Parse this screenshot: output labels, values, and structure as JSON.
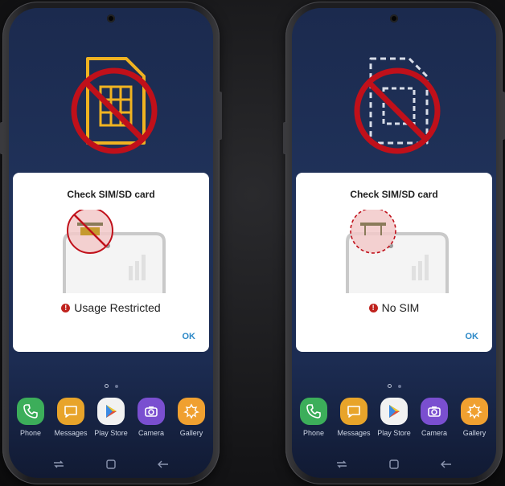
{
  "phones": [
    {
      "dialog": {
        "title": "Check SIM/SD card",
        "status": "Usage Restricted",
        "ok_label": "OK"
      }
    },
    {
      "dialog": {
        "title": "Check SIM/SD card",
        "status": "No SIM",
        "ok_label": "OK"
      }
    }
  ],
  "dock": {
    "apps": [
      {
        "label": "Phone",
        "icon": "phone-icon",
        "color": "#3cae5a"
      },
      {
        "label": "Messages",
        "icon": "messages-icon",
        "color": "#e8a42a"
      },
      {
        "label": "Play Store",
        "icon": "play-store-icon",
        "color": "#f2f2f2"
      },
      {
        "label": "Camera",
        "icon": "camera-icon",
        "color": "#7a4fd0"
      },
      {
        "label": "Gallery",
        "icon": "gallery-icon",
        "color": "#f0a030"
      }
    ]
  },
  "colors": {
    "prohibit_red": "#c0101a",
    "sim_gold": "#f0b321",
    "ok_blue": "#2b88c7",
    "warning_red": "#c0231e"
  }
}
